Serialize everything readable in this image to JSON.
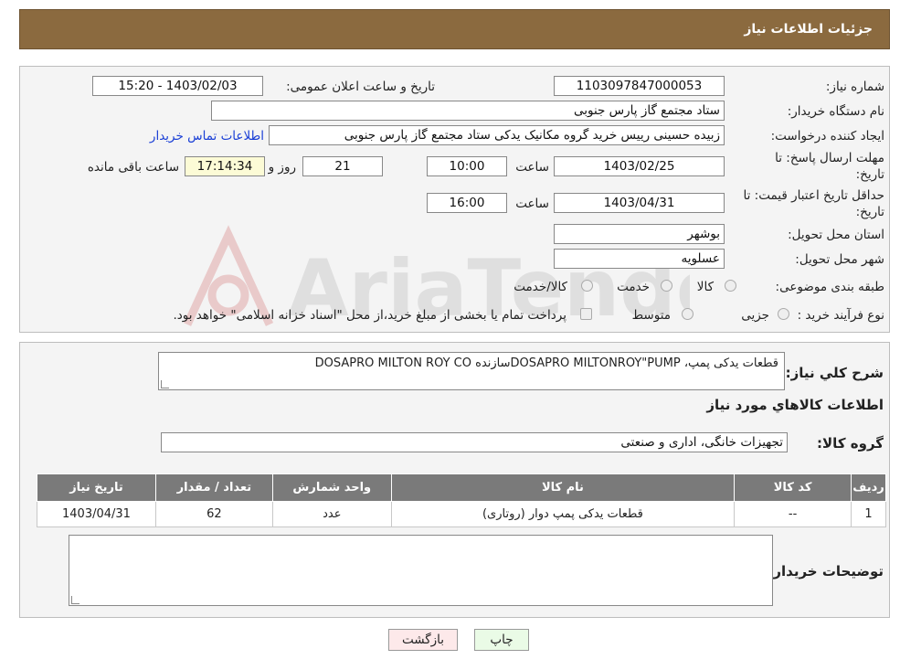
{
  "header": {
    "title": "جزئیات اطلاعات نیاز"
  },
  "form": {
    "need_number_label": "شماره نیاز:",
    "need_number": "1103097847000053",
    "announce_label": "تاریخ و ساعت اعلان عمومی:",
    "announce_value": "1403/02/03 - 15:20",
    "buyer_org_label": "نام دستگاه خریدار:",
    "buyer_org": "ستاد مجتمع گاز پارس جنوبی",
    "creator_label": "ایجاد کننده درخواست:",
    "creator": "زبیده حسینی رییس خرید گروه مکانیک یدکی ستاد مجتمع گاز پارس جنوبی",
    "contact_link": "اطلاعات تماس خریدار",
    "deadline_label_1": "مهلت ارسال پاسخ: تا",
    "deadline_label_2": "تاریخ:",
    "deadline_date": "1403/02/25",
    "time_label": "ساعت",
    "deadline_time": "10:00",
    "days": "21",
    "days_label": "روز و",
    "remaining_time": "17:14:34",
    "remaining_label": "ساعت باقی مانده",
    "validity_label_1": "حداقل تاریخ اعتبار قیمت: تا",
    "validity_label_2": "تاریخ:",
    "validity_date": "1403/04/31",
    "validity_time": "16:00",
    "province_label": "استان محل تحویل:",
    "province": "بوشهر",
    "city_label": "شهر محل تحویل:",
    "city": "عسلویه",
    "category_label": "طبقه بندی موضوعی:",
    "category_options": [
      "کالا",
      "خدمت",
      "کالا/خدمت"
    ],
    "process_label": "نوع فرآیند خرید :",
    "process_options": [
      "جزیی",
      "متوسط"
    ],
    "process_note": "پرداخت تمام یا بخشی از مبلغ خرید،از محل \"اسناد خزانه اسلامی\" خواهد بود."
  },
  "details": {
    "description_label": "شرح کلي نياز:",
    "description": "قطعات یدکی پمپ، DOSAPRO MILTONROY\"PUMPسازنده DOSAPRO MILTON ROY CO",
    "goods_info_title": "اطلاعات کالاهاي مورد نياز",
    "goods_group_label": "گروه کالا:",
    "goods_group": "تجهیزات خانگی، اداری و صنعتی",
    "table": {
      "headers": [
        "ردیف",
        "کد کالا",
        "نام کالا",
        "واحد شمارش",
        "تعداد / مقدار",
        "تاریخ نیاز"
      ],
      "rows": [
        [
          "1",
          "--",
          "قطعات یدکی پمپ دوار (روتاری)",
          "عدد",
          "62",
          "1403/04/31"
        ]
      ]
    },
    "buyer_notes_label": "توضیحات خریدار:",
    "buyer_notes": ""
  },
  "buttons": {
    "print": "چاپ",
    "back": "بازگشت"
  },
  "colors": {
    "header_bg": "#8b6a3f",
    "table_header_bg": "#7a7a7a",
    "back_button_bg": "#fde9ea",
    "print_button_bg": "#eafbe6"
  }
}
